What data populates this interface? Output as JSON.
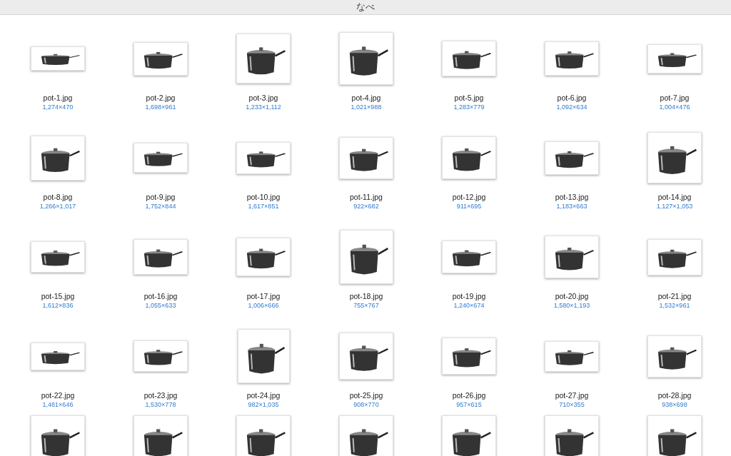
{
  "window": {
    "title": "なべ"
  },
  "files": [
    {
      "name": "pot-1.jpg",
      "dimensions": "1,274×470"
    },
    {
      "name": "pot-2.jpg",
      "dimensions": "1,698×961"
    },
    {
      "name": "pot-3.jpg",
      "dimensions": "1,233×1,112"
    },
    {
      "name": "pot-4.jpg",
      "dimensions": "1,021×988"
    },
    {
      "name": "pot-5.jpg",
      "dimensions": "1,283×779"
    },
    {
      "name": "pot-6.jpg",
      "dimensions": "1,092×634"
    },
    {
      "name": "pot-7.jpg",
      "dimensions": "1,004×476"
    },
    {
      "name": "pot-8.jpg",
      "dimensions": "1,266×1,017"
    },
    {
      "name": "pot-9.jpg",
      "dimensions": "1,752×844"
    },
    {
      "name": "pot-10.jpg",
      "dimensions": "1,617×851"
    },
    {
      "name": "pot-11.jpg",
      "dimensions": "922×682"
    },
    {
      "name": "pot-12.jpg",
      "dimensions": "911×695"
    },
    {
      "name": "pot-13.jpg",
      "dimensions": "1,183×663"
    },
    {
      "name": "pot-14.jpg",
      "dimensions": "1,127×1,053"
    },
    {
      "name": "pot-15.jpg",
      "dimensions": "1,612×836"
    },
    {
      "name": "pot-16.jpg",
      "dimensions": "1,055×633"
    },
    {
      "name": "pot-17.jpg",
      "dimensions": "1,006×666"
    },
    {
      "name": "pot-18.jpg",
      "dimensions": "755×767"
    },
    {
      "name": "pot-19.jpg",
      "dimensions": "1,240×674"
    },
    {
      "name": "pot-20.jpg",
      "dimensions": "1,580×1,193"
    },
    {
      "name": "pot-21.jpg",
      "dimensions": "1,532×961"
    },
    {
      "name": "pot-22.jpg",
      "dimensions": "1,481×646"
    },
    {
      "name": "pot-23.jpg",
      "dimensions": "1,530×778"
    },
    {
      "name": "pot-24.jpg",
      "dimensions": "982×1,035"
    },
    {
      "name": "pot-25.jpg",
      "dimensions": "908×770"
    },
    {
      "name": "pot-26.jpg",
      "dimensions": "957×615"
    },
    {
      "name": "pot-27.jpg",
      "dimensions": "710×355"
    },
    {
      "name": "pot-28.jpg",
      "dimensions": "938×698"
    }
  ]
}
